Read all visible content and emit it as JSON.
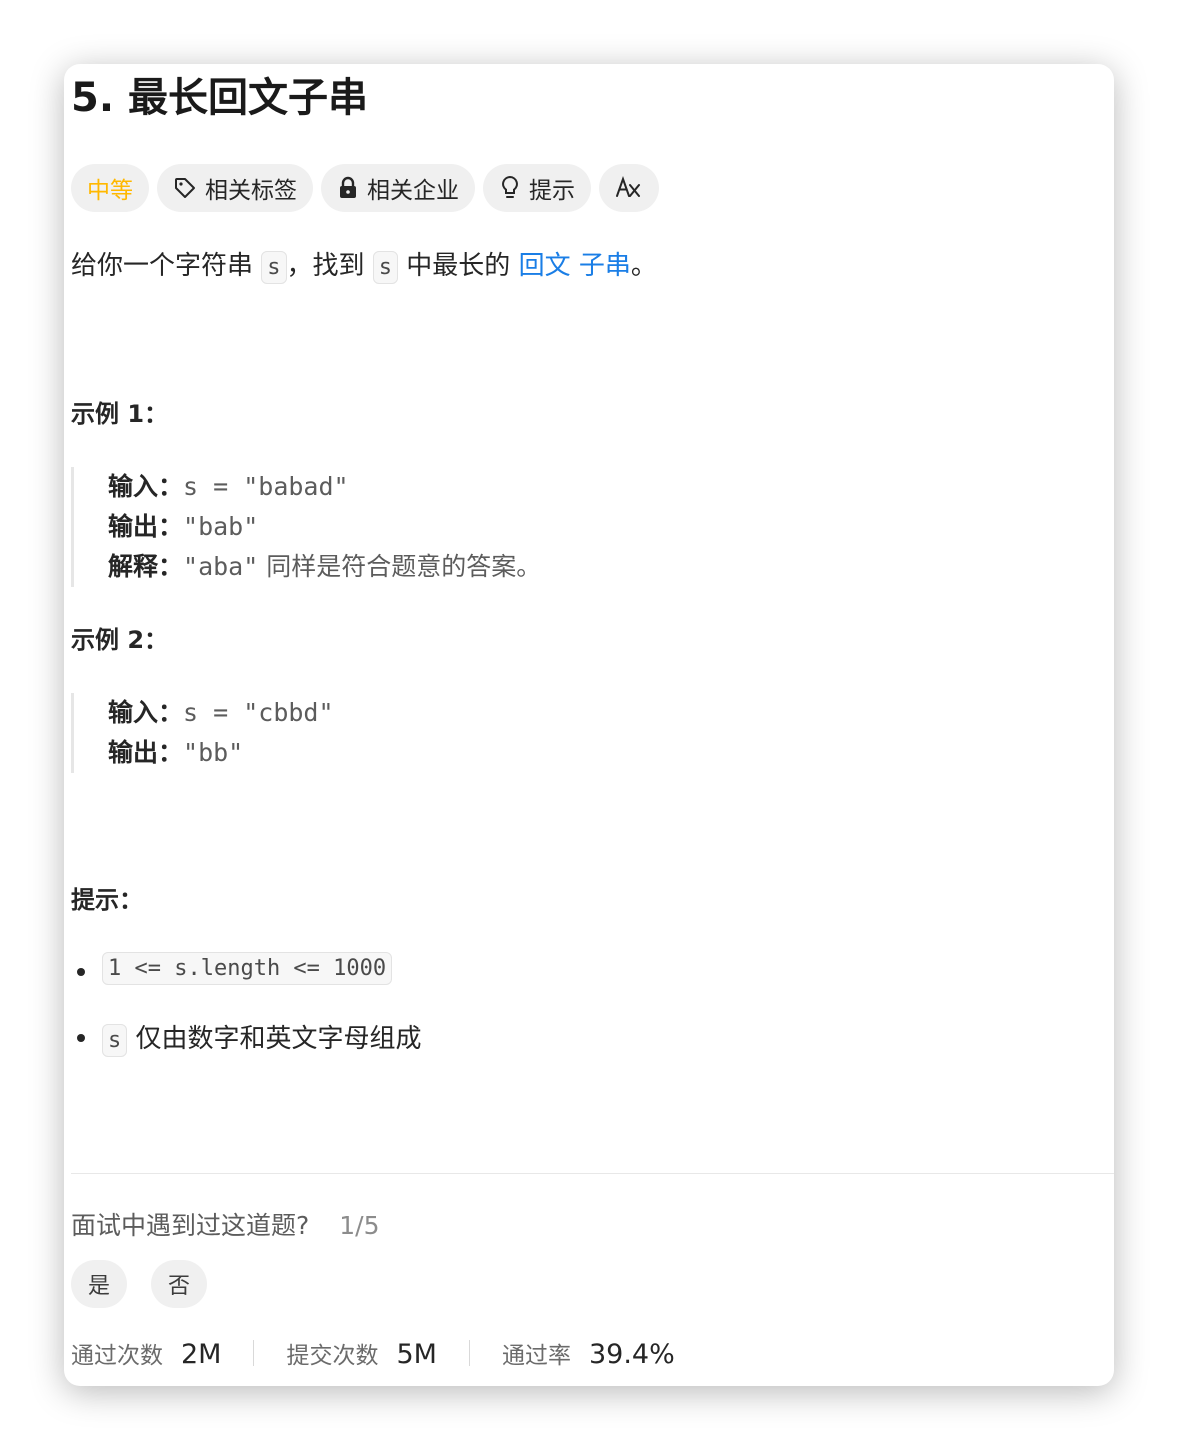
{
  "title": "5. 最长回文子串",
  "tags": {
    "difficulty": "中等",
    "related_tags": "相关标签",
    "related_companies": "相关企业",
    "hint": "提示",
    "translate_icon": "translate-icon"
  },
  "description": {
    "part1": "给你一个字符串 ",
    "code1": "s",
    "part2": "，找到 ",
    "code2": "s",
    "part3": " 中最长的 ",
    "link1": "回文",
    "link2": "子串",
    "part4": "。"
  },
  "example1": {
    "heading": "示例 1：",
    "input_label": "输入：",
    "input_value": "s = \"babad\"",
    "output_label": "输出：",
    "output_value": "\"bab\"",
    "explain_label": "解释：",
    "explain_value": "\"aba\"",
    "explain_text": " 同样是符合题意的答案。"
  },
  "example2": {
    "heading": "示例 2：",
    "input_label": "输入：",
    "input_value": "s = \"cbbd\"",
    "output_label": "输出：",
    "output_value": "\"bb\""
  },
  "constraints": {
    "heading": "提示：",
    "item1_code": "1 <= s.length <= 1000",
    "item2_code": "s",
    "item2_text": "仅由数字和英文字母组成"
  },
  "interview": {
    "question": "面试中遇到过这道题?",
    "ratio": "1/5",
    "yes": "是",
    "no": "否"
  },
  "stats": {
    "accepted_label": "通过次数",
    "accepted_value": "2M",
    "submissions_label": "提交次数",
    "submissions_value": "5M",
    "rate_label": "通过率",
    "rate_value": "39.4%"
  },
  "colors": {
    "difficulty_medium": "#ffb800",
    "link": "#1a7ee6",
    "tag_bg": "#f0f0f0"
  }
}
